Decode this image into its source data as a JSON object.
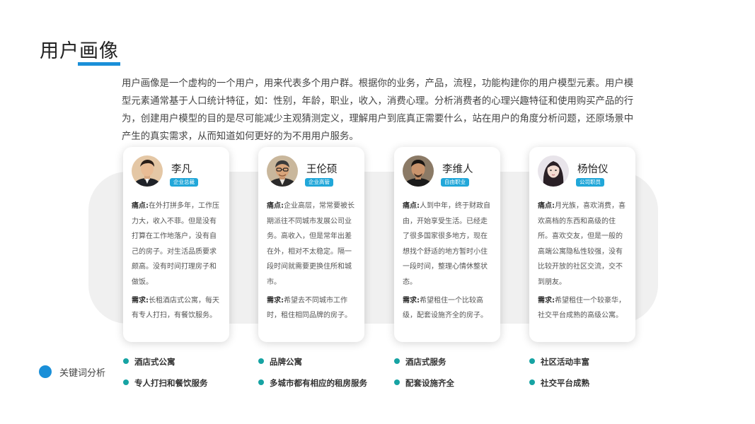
{
  "page": {
    "title": "用户画像",
    "intro": "用户画像是一个虚构的一个用户，用来代表多个用户群。根据你的业务，产品，流程，功能构建你的用户模型元素。用户模型元素通常基于人口统计特征，如：性别，年龄，职业，收入，消费心理。分析消费者的心理兴趣特征和使用购买产品的行为，创建用户模型的目的是尽可能减少主观猜测定义，理解用户到底真正需要什么，站在用户的角度分析问题，还原场景中产生的真实需求，从而知道如何更好的为不用用户服务。"
  },
  "colors": {
    "accent": "#1a8fd8",
    "badge": "#21a7d9",
    "keyword_dot": "#16a3a3",
    "band": "#f0f0f0"
  },
  "personas": [
    {
      "name": "李凡",
      "badge": "企业总裁",
      "pain_label": "痛点:",
      "pain": "在外打拼多年，工作压力大，收入不菲。但是没有打算在工作地落户，没有自己的房子。对生活品质要求颇高。没有时间打理房子和做饭。",
      "need_label": "需求:",
      "need": "长租酒店式公寓，每天有专人打扫，有餐饮服务。",
      "keywords": [
        "酒店式公寓",
        "专人打扫和餐饮服务"
      ]
    },
    {
      "name": "王伦硕",
      "badge": "企业高管",
      "pain_label": "痛点:",
      "pain": "企业高层，常常要被长期派往不同城市发展公司业务。高收入，但是常年出差在外，相对不太稳定。隔一段时间就需要更换住所和城市。",
      "need_label": "需求:",
      "need": "希望去不同城市工作时，租住相同品牌的房子。",
      "keywords": [
        "品牌公寓",
        "多城市都有相应的租房服务"
      ]
    },
    {
      "name": "李维人",
      "badge": "自由职业",
      "pain_label": "痛点:",
      "pain": "人到中年，终于财政自由，开始享受生活。已经走了很多国家很多地方，现在想找个舒适的地方暂时小住一段时间，整理心情休整状态。",
      "need_label": "需求:",
      "need": "希望租住一个比较高级，配套设施齐全的房子。",
      "keywords": [
        "酒店式服务",
        "配套设施齐全"
      ]
    },
    {
      "name": "杨怡仪",
      "badge": "公司职员",
      "pain_label": "痛点:",
      "pain": "月光族，喜欢消费，喜欢高档的东西和高级的住所。喜欢交友，但是一般的高端公寓隐私性较强，没有比较开放的社区交流，交不到朋友。",
      "need_label": "需求:",
      "need": "希望租住一个较豪华，社交平台成熟的高级公寓。",
      "keywords": [
        "社区活动丰富",
        "社交平台成熟"
      ]
    }
  ],
  "keywords_section": {
    "label": "关键词分析",
    "icon": "circle-icon"
  },
  "avatars": [
    "man-portrait-icon",
    "older-man-glasses-portrait-icon",
    "man-portrait-icon",
    "woman-portrait-icon"
  ]
}
